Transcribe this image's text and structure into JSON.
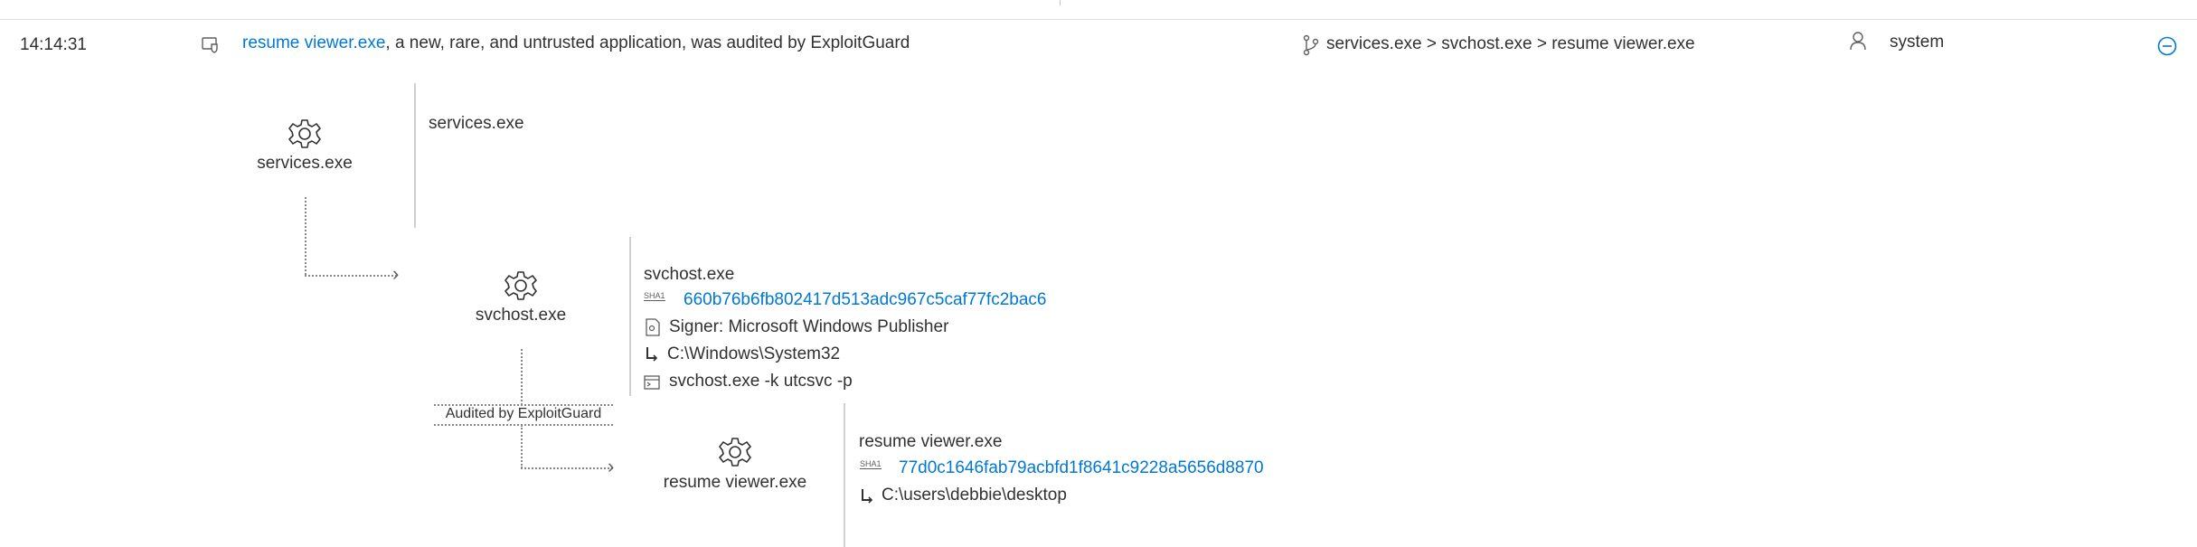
{
  "event": {
    "time": "14:14:31",
    "process_link": "resume viewer.exe",
    "description": ", a new, rare, and untrusted application, was audited by ExploitGuard",
    "process_path": "services.exe > svchost.exe > resume viewer.exe",
    "user": "system",
    "collapse_icon": "minus-circle-icon"
  },
  "tree": {
    "services": {
      "node_label": "services.exe",
      "detail_name": "services.exe"
    },
    "svchost": {
      "node_label": "svchost.exe",
      "detail_name": "svchost.exe",
      "sha1_tag": "SHA1",
      "sha1": "660b76b6fb802417d513adc967c5caf77fc2bac6",
      "signer": "Signer: Microsoft Windows Publisher",
      "path": "C:\\Windows\\System32",
      "command": "svchost.exe -k utcsvc -p"
    },
    "edge_label": "Audited by ExploitGuard",
    "resume": {
      "node_label": "resume viewer.exe",
      "detail_name": "resume viewer.exe",
      "sha1_tag": "SHA1",
      "sha1": "77d0c1646fab79acbfd1f8641c9228a5656d8870",
      "path": "C:\\users\\debbie\\desktop"
    }
  }
}
